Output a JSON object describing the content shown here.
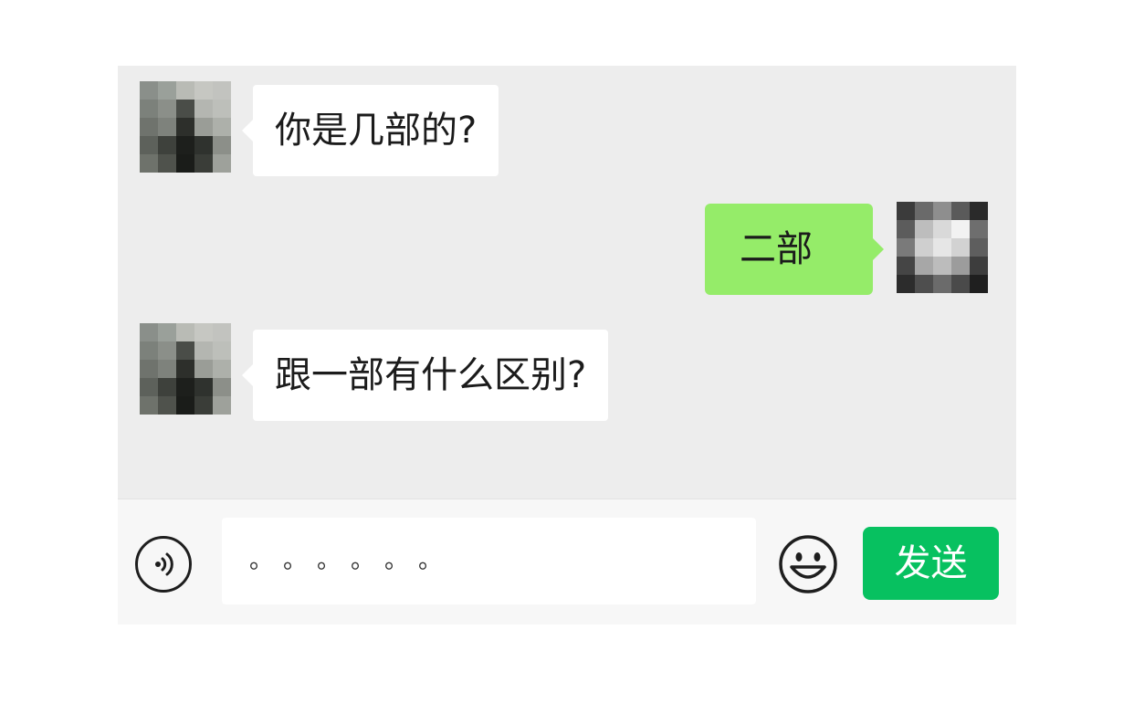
{
  "messages": [
    {
      "side": "left",
      "text": "你是几部的?"
    },
    {
      "side": "right",
      "text": "二部"
    },
    {
      "side": "left",
      "text": "跟一部有什么区别?"
    }
  ],
  "input": {
    "value": "。。。。。。"
  },
  "send_button": {
    "label": "发送"
  },
  "icons": {
    "voice": "voice-icon",
    "emoji": "emoji-icon"
  },
  "colors": {
    "chat_bg": "#ededed",
    "incoming_bubble": "#ffffff",
    "outgoing_bubble": "#95ec69",
    "send_button": "#07c160"
  }
}
